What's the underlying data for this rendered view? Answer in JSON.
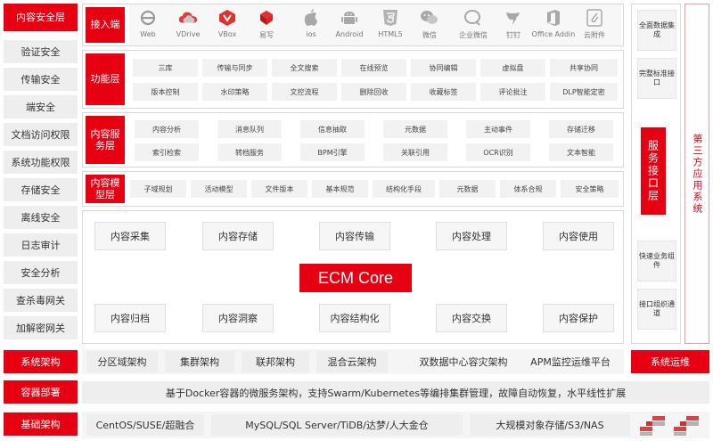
{
  "left_panel": {
    "title": "内容安全层",
    "items": [
      "验证安全",
      "传输安全",
      "端安全",
      "文档访问权限",
      "系统功能权限",
      "存储安全",
      "离线安全",
      "日志审计",
      "安全分析",
      "查杀毒网关",
      "加解密网关"
    ]
  },
  "access_layer": {
    "label": "接入端",
    "clients": [
      {
        "name": "Web",
        "icon": "ie-icon"
      },
      {
        "name": "VDrive",
        "icon": "cloud-icon"
      },
      {
        "name": "VBox",
        "icon": "vbox-icon"
      },
      {
        "name": "易写",
        "icon": "write-icon"
      },
      {
        "name": "ios",
        "icon": "apple-icon"
      },
      {
        "name": "Android",
        "icon": "android-icon"
      },
      {
        "name": "HTML5",
        "icon": "html5-icon"
      },
      {
        "name": "微信",
        "icon": "wechat-icon"
      },
      {
        "name": "企业微信",
        "icon": "wechat-work-icon"
      },
      {
        "name": "钉钉",
        "icon": "dingtalk-icon"
      },
      {
        "name": "Office Addin",
        "icon": "office-icon"
      },
      {
        "name": "云附件",
        "icon": "attachment-icon"
      }
    ]
  },
  "function_layer": {
    "label": "功能层",
    "row1": [
      "三库",
      "传输与同步",
      "全文搜索",
      "在线预览",
      "协同编辑",
      "虚拟盘",
      "共享协同"
    ],
    "row2": [
      "版本控制",
      "水印策略",
      "文控流程",
      "删除回收",
      "收藏标签",
      "评论批注",
      "DLP智能定密"
    ]
  },
  "content_service_layer": {
    "label": "内容服务层",
    "row1": [
      "内容分析",
      "消息队列",
      "信息抽取",
      "元数据",
      "主动事件",
      "存储迁移"
    ],
    "row2": [
      "索引检索",
      "转档服务",
      "BPM引擎",
      "关联引用",
      "OCR识别",
      "文本智能"
    ]
  },
  "content_model_layer": {
    "label": "内容模型层",
    "items": [
      "子域规划",
      "活动模型",
      "文件版本",
      "基本规范",
      "结构化手段",
      "元数据",
      "体系合规",
      "安全策略"
    ]
  },
  "core": {
    "title": "ECM Core",
    "top": [
      "内容采集",
      "内容存储",
      "内容传输",
      "内容处理",
      "内容使用"
    ],
    "bottom": [
      "内容归档",
      "内容洞察",
      "内容结构化",
      "内容交换",
      "内容保护"
    ]
  },
  "right_panel": {
    "items_top": [
      "全面数据集成",
      "完整标准接口"
    ],
    "service_interface": "服务接口层",
    "items_bottom": [
      "快速业务组件",
      "接口组织通道"
    ],
    "third_party": "第三方应用系统"
  },
  "system_arch": {
    "label": "系统架构",
    "items": [
      "分区域架构",
      "集群架构",
      "联邦架构",
      "混合云架构",
      "双数据中心容灾架构",
      "APM监控运维平台"
    ],
    "ops": "系统运维"
  },
  "container": {
    "label": "容器部署",
    "text": "基于Docker容器的微服务架构，支持Swarm/Kubernetes等编排集群管理，故障自动恢复，水平线性扩展"
  },
  "infra": {
    "label": "基础架构",
    "items": [
      "CentOS/SUSE/超融合",
      "MySQL/SQL Server/TiDB/达梦/人大金仓",
      "大规模对象存储/S3/NAS"
    ]
  },
  "colors": {
    "accent": "#e60012",
    "grey": "#eeeeee"
  }
}
